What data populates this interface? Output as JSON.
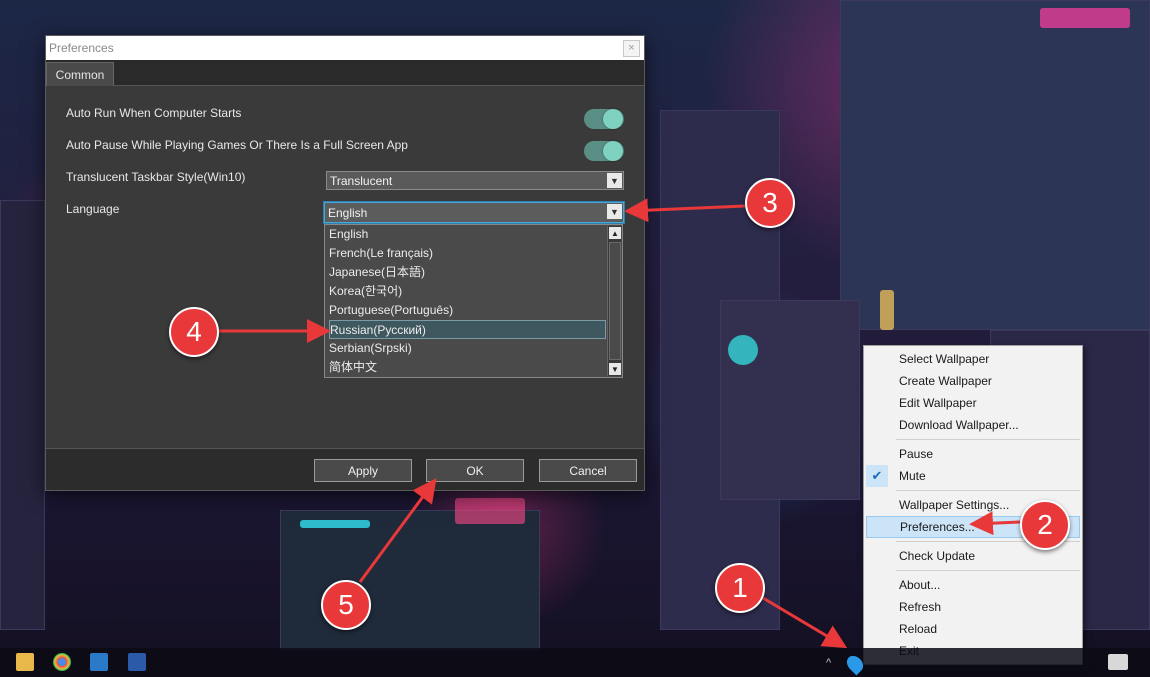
{
  "dialog": {
    "title": "Preferences",
    "close_glyph": "×",
    "tab": "Common",
    "settings": {
      "auto_run": {
        "label": "Auto Run When Computer Starts",
        "enabled": true
      },
      "auto_pause": {
        "label": "Auto Pause While Playing Games Or There Is a Full Screen App",
        "enabled": true
      },
      "taskbar_style": {
        "label": "Translucent Taskbar Style(Win10)",
        "value": "Translucent"
      },
      "language": {
        "label": "Language",
        "value": "English"
      }
    },
    "language_options": [
      "English",
      "French(Le français)",
      "Japanese(日本語)",
      "Korea(한국어)",
      "Portuguese(Português)",
      "Russian(Русский)",
      "Serbian(Srpski)",
      "简体中文"
    ],
    "highlighted_option": "Russian(Русский)",
    "buttons": {
      "apply": "Apply",
      "ok": "OK",
      "cancel": "Cancel"
    }
  },
  "tray_menu": {
    "items": [
      "Select Wallpaper",
      "Create Wallpaper",
      "Edit Wallpaper",
      "Download Wallpaper...",
      "Pause",
      "Mute",
      "Wallpaper Settings...",
      "Preferences...",
      "Check Update",
      "About...",
      "Refresh",
      "Reload",
      "Exit"
    ],
    "checked_item": "Mute",
    "highlighted_item": "Preferences..."
  },
  "annotations": [
    "1",
    "2",
    "3",
    "4",
    "5"
  ],
  "colors": {
    "dialog_bg": "#3a3a3a",
    "toggle_on": "#7fd1c0",
    "badge": "#e8383a",
    "menu_highlight": "#cce4f7"
  }
}
